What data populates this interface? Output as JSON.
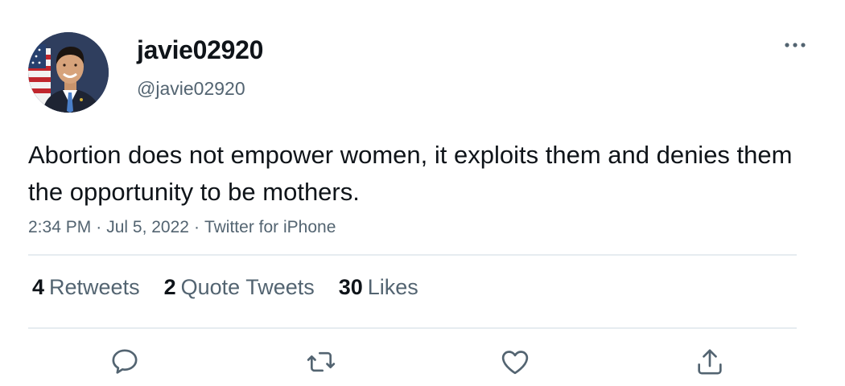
{
  "tweet": {
    "user": {
      "display_name": "javie02920",
      "handle": "@javie02920",
      "avatar_icon": "user-avatar"
    },
    "text": "Abortion does not empower women, it exploits them and denies them the opportunity to be mothers.",
    "meta": {
      "time": "2:34 PM",
      "separator": "·",
      "date": "Jul 5, 2022",
      "source": "Twitter for iPhone"
    },
    "stats": {
      "retweets_count": "4",
      "retweets_label": "Retweets",
      "quotes_count": "2",
      "quotes_label": "Quote Tweets",
      "likes_count": "30",
      "likes_label": "Likes"
    },
    "actions": {
      "reply_icon": "reply-icon",
      "retweet_icon": "retweet-icon",
      "like_icon": "heart-icon",
      "share_icon": "share-icon"
    }
  },
  "colors": {
    "text_primary": "#0f1419",
    "text_secondary": "#536471",
    "divider": "#e6ecf0"
  }
}
